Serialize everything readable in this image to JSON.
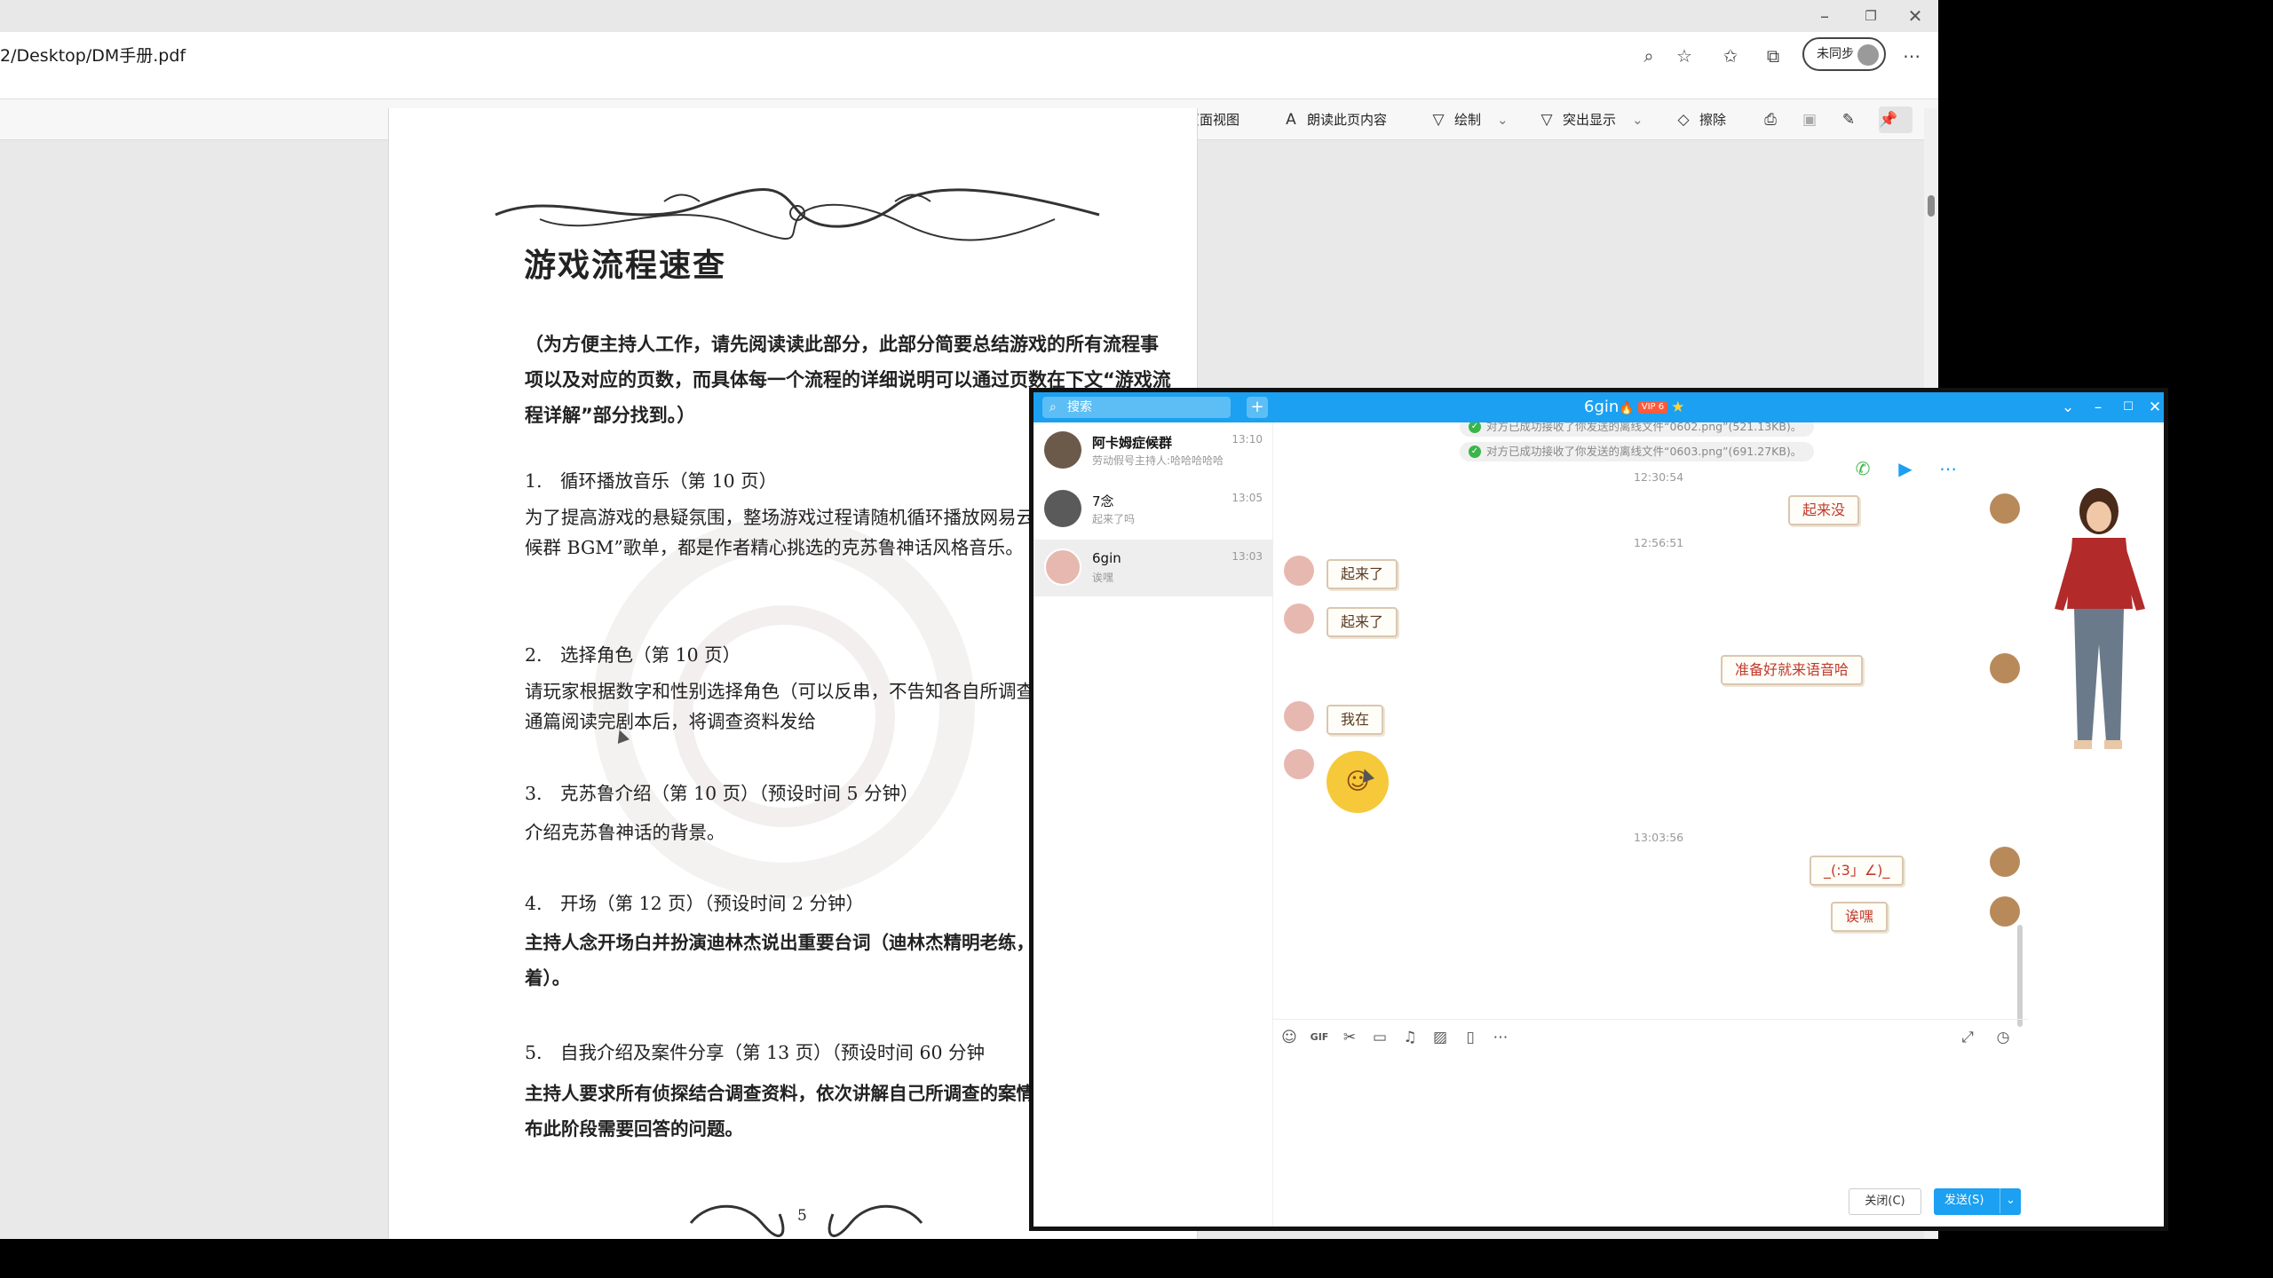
{
  "browser": {
    "url": "2/Desktop/DM手册.pdf",
    "sync_label": "未同步",
    "toolbar": {
      "page_view": "页面视图",
      "read_aloud": "朗读此页内容",
      "draw": "绘制",
      "highlight": "突出显示",
      "erase": "擦除"
    }
  },
  "pdf": {
    "title": "游戏流程速查",
    "intro": "（为方便主持人工作，请先阅读读此部分，此部分简要总结游戏的所有流程事项以及对应的页数，而具体每一个流程的详细说明可以通过页数在下文“游戏流程详解”部分找到。）",
    "items": [
      {
        "heading": "1.　循环播放音乐（第 10 页）",
        "body": "为了提高游戏的悬疑氛围，整场游戏过程请随机循环播放网易云音乐的“阿卡姆症候群 BGM”歌单，都是作者精心挑选的克苏鲁神话风格音乐。"
      },
      {
        "heading": "2.　选择角色（第 10 页）",
        "body": "请玩家根据数字和性别选择角色（可以反串，不告知各自所调查的案件），等他们通篇阅读完剧本后，将调查资料发给"
      },
      {
        "heading": "3.　克苏鲁介绍（第 10 页）（预设时间 5 分钟）",
        "body": "介绍克苏鲁神话的背景。"
      },
      {
        "heading": "4.　开场（第 12 页）（预设时间 2 分钟）",
        "body": "主持人念开场白并扮演迪林杰说出重要台词（迪林杰精明老练，语气阴冷而沉着）。"
      },
      {
        "heading": "5.　自我介绍及案件分享（第 13 页）（预设时间 60 分钟",
        "body": "主持人要求所有侦探结合调查资料，依次讲解自己所调查的案情。主持人同时公布此阶段需要回答的问题。"
      }
    ],
    "page_number": "5"
  },
  "chat": {
    "search_placeholder": "搜索",
    "title": "6gin",
    "vip_label": "VIP 6",
    "conversations": [
      {
        "name": "阿卡姆症候群",
        "time": "13:10",
        "last": "劳动假号主持人:哈哈哈哈哈"
      },
      {
        "name": "7念",
        "time": "13:05",
        "last": "起来了吗"
      },
      {
        "name": "6gin",
        "time": "13:03",
        "last": "诶嘿"
      }
    ],
    "system_messages": [
      "对方已成功接收了你发送的离线文件“0602.png”(521.13KB)。",
      "对方已成功接收了你发送的离线文件“0603.png”(691.27KB)。"
    ],
    "timestamps": [
      "12:30:54",
      "12:56:51",
      "13:03:56"
    ],
    "messages": {
      "m1": "起来没",
      "m2": "起来了",
      "m3": "起来了",
      "m4": "准备好就来语音哈",
      "m5": "我在",
      "m6": "_(:3」∠)_",
      "m7": "诶嘿"
    },
    "buttons": {
      "close": "关闭(C)",
      "send": "发送(S)"
    }
  }
}
